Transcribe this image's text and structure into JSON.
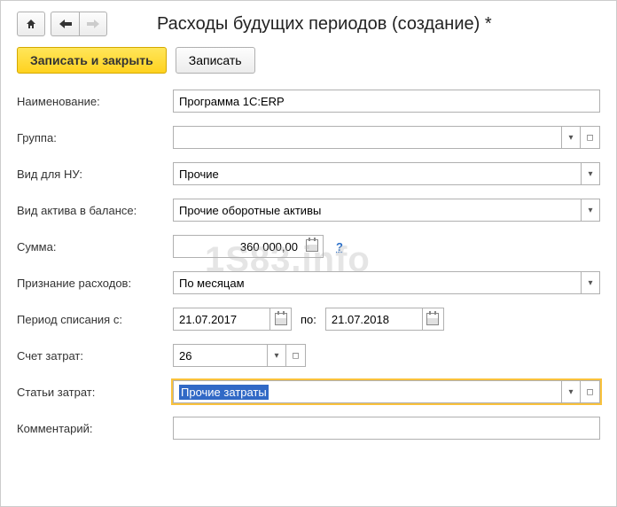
{
  "title": "Расходы будущих периодов (создание) *",
  "actions": {
    "save_close": "Записать и закрыть",
    "save": "Записать"
  },
  "labels": {
    "name": "Наименование:",
    "group": "Группа:",
    "tax_type": "Вид для НУ:",
    "asset_type": "Вид актива в балансе:",
    "sum": "Сумма:",
    "recognition": "Признание расходов:",
    "period_from": "Период списания с:",
    "period_to": "по:",
    "cost_account": "Счет затрат:",
    "cost_items": "Статьи затрат:",
    "comment": "Комментарий:"
  },
  "values": {
    "name": "Программа 1C:ERP",
    "group": "",
    "tax_type": "Прочие",
    "asset_type": "Прочие оборотные активы",
    "sum": "360 000,00",
    "recognition": "По месяцам",
    "period_from": "21.07.2017",
    "period_to": "21.07.2018",
    "cost_account": "26",
    "cost_items": "Прочие затраты",
    "comment": ""
  },
  "watermark": "1S83.info"
}
